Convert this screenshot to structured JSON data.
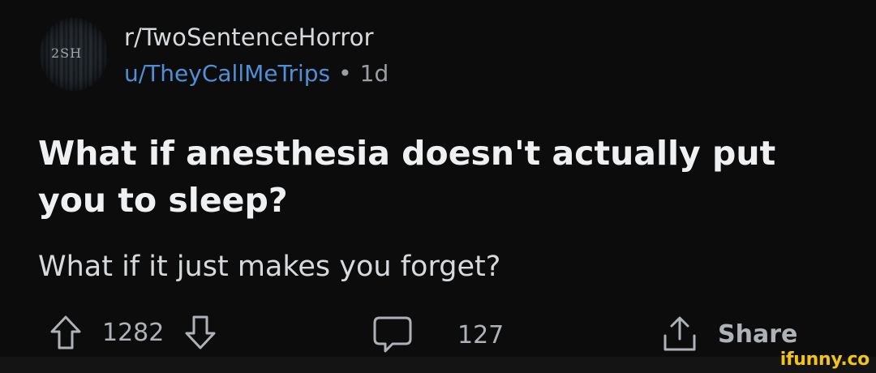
{
  "post": {
    "subreddit": "r/TwoSentenceHorror",
    "username": "u/TheyCallMeTrips",
    "separator": "•",
    "age": "1d",
    "avatar_text": "2SH",
    "title": "What if anesthesia doesn't actually put you to sleep?",
    "body": "What if it just makes you forget?"
  },
  "actions": {
    "upvote_icon": "upvote-arrow-icon",
    "score": "1282",
    "downvote_icon": "downvote-arrow-icon",
    "comment_icon": "comment-bubble-icon",
    "comments": "127",
    "share_icon": "share-icon",
    "share_label": "Share"
  },
  "watermark": "ifunny.co",
  "colors": {
    "background": "#0c0c0d",
    "username": "#4f8fd7",
    "title": "#eef0f2",
    "muted": "#9a9ea2",
    "watermark": "#f2c41b"
  }
}
